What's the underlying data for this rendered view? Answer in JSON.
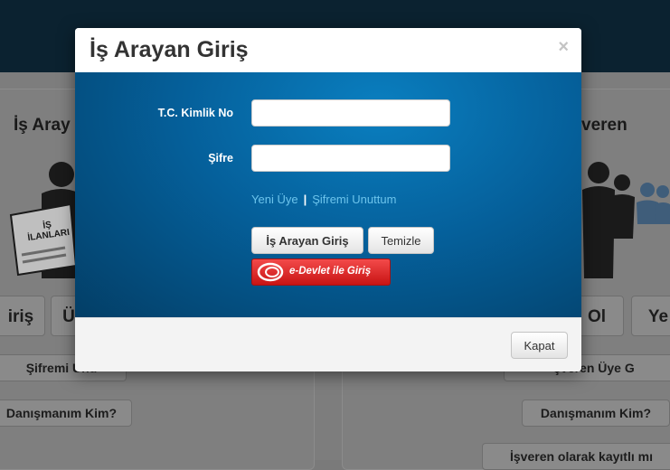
{
  "background": {
    "left_panel_title": "İş Aray",
    "right_panel_title": "veren",
    "left_sign_text": "İŞ İLANLARI",
    "buttons": {
      "giris": "iriş",
      "u": "Ü",
      "uye_ol": "Ol",
      "ye": "Ye",
      "sifremi_unuttum": "Şifremi Unu",
      "danismanim_left": "Danışmanım Kim?",
      "isveren_uye": "şveren Üye G",
      "danismanim_right": "Danışmanım Kim?",
      "isveren_kayitli": "İşveren olarak kayıtlı mı"
    }
  },
  "modal": {
    "title": "İş Arayan Giriş",
    "close_symbol": "×",
    "form": {
      "tc_label": "T.C. Kimlik No",
      "tc_value": "",
      "tc_placeholder": "",
      "password_label": "Şifre",
      "password_value": "",
      "password_placeholder": ""
    },
    "links": {
      "new_member": "Yeni Üye",
      "separator": "|",
      "forgot_password": "Şifremi Unuttum"
    },
    "buttons": {
      "login": "İş Arayan Giriş",
      "clear": "Temizle",
      "edevlet": "e-Devlet ile Giriş"
    },
    "footer": {
      "close_button": "Kapat"
    }
  },
  "colors": {
    "modal_body_blue": "#05609b",
    "link_blue": "#6cc4ec",
    "edevlet_red": "#e02a2a",
    "header_dark": "#0b2230"
  }
}
